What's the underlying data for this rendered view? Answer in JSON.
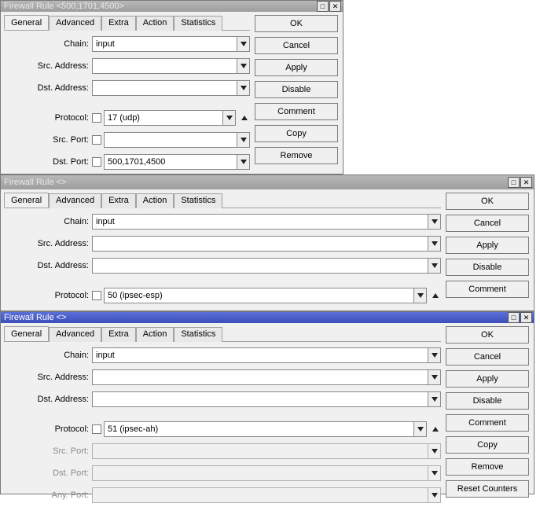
{
  "tabs": [
    "General",
    "Advanced",
    "Extra",
    "Action",
    "Statistics"
  ],
  "labels": {
    "chain": "Chain:",
    "src_addr": "Src. Address:",
    "dst_addr": "Dst. Address:",
    "protocol": "Protocol:",
    "src_port": "Src. Port:",
    "dst_port": "Dst. Port:",
    "any_port": "Any. Port:"
  },
  "buttons": {
    "ok": "OK",
    "cancel": "Cancel",
    "apply": "Apply",
    "disable": "Disable",
    "comment": "Comment",
    "copy": "Copy",
    "remove": "Remove",
    "reset_counters": "Reset Counters"
  },
  "windows": [
    {
      "id": "w1",
      "title": "Firewall Rule <500,1701,4500>",
      "active_titlebar": false,
      "fields": {
        "chain": "input",
        "src_addr": "",
        "dst_addr": "",
        "protocol": "17 (udp)",
        "src_port": "",
        "dst_port": "500,1701,4500"
      },
      "side_buttons": [
        "ok",
        "cancel",
        "apply",
        "disable",
        "comment",
        "copy",
        "remove"
      ]
    },
    {
      "id": "w2",
      "title": "Firewall Rule <>",
      "active_titlebar": false,
      "fields": {
        "chain": "input",
        "src_addr": "",
        "dst_addr": "",
        "protocol": "50 (ipsec-esp)"
      },
      "side_buttons": [
        "ok",
        "cancel",
        "apply",
        "disable",
        "comment"
      ]
    },
    {
      "id": "w3",
      "title": "Firewall Rule <>",
      "active_titlebar": true,
      "fields": {
        "chain": "input",
        "src_addr": "",
        "dst_addr": "",
        "protocol": "51 (ipsec-ah)",
        "src_port": "",
        "dst_port": "",
        "any_port": ""
      },
      "ports_disabled": true,
      "side_buttons": [
        "ok",
        "cancel",
        "apply",
        "disable",
        "comment",
        "copy",
        "remove",
        "reset_counters"
      ]
    }
  ]
}
